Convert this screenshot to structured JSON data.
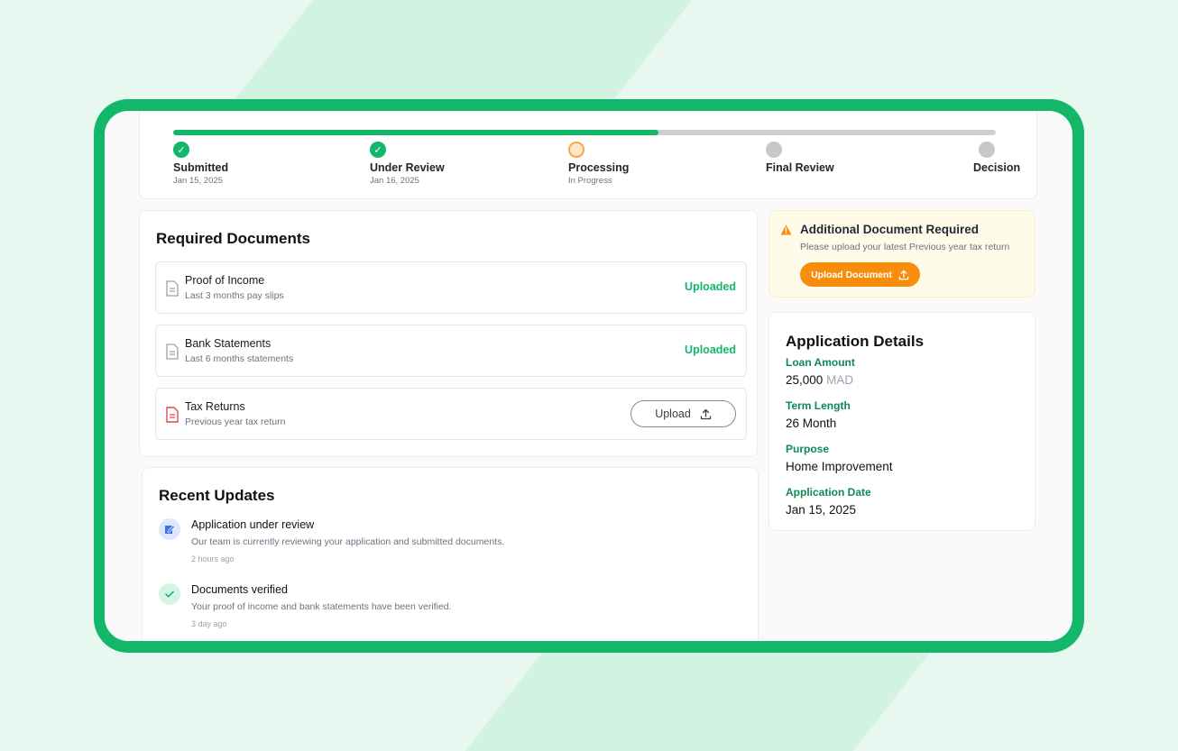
{
  "progress": {
    "fraction": 0.59,
    "steps": [
      {
        "label": "Submitted",
        "sub": "Jan 15, 2025",
        "state": "done"
      },
      {
        "label": "Under Review",
        "sub": "Jan 16, 2025",
        "state": "done"
      },
      {
        "label": "Processing",
        "sub": "In Progress",
        "state": "active"
      },
      {
        "label": "Final Review",
        "sub": "",
        "state": "pending"
      },
      {
        "label": "Decision",
        "sub": "",
        "state": "pending"
      }
    ]
  },
  "documents": {
    "title": "Required Documents",
    "items": [
      {
        "name": "Proof of Income",
        "desc": "Last 3 months pay slips",
        "status": "Uploaded"
      },
      {
        "name": "Bank Statements",
        "desc": "Last 6 months statements",
        "status": "Uploaded"
      },
      {
        "name": "Tax Returns",
        "desc": "Previous year tax return",
        "action": "Upload"
      }
    ]
  },
  "alert": {
    "title": "Additional Document Required",
    "desc": "Please upload your latest Previous year tax return",
    "button": "Upload Document"
  },
  "details": {
    "title": "Application Details",
    "loan_amount_label": "Loan Amount",
    "loan_amount_value": "25,000",
    "loan_amount_unit": "MAD",
    "term_label": "Term Length",
    "term_value": "26 Month",
    "purpose_label": "Purpose",
    "purpose_value": "Home Improvement",
    "date_label": "Application Date",
    "date_value": "Jan 15, 2025"
  },
  "updates": {
    "title": "Recent Updates",
    "items": [
      {
        "title": "Application under review",
        "desc": "Our team is currently reviewing your application and submitted documents.",
        "time": "2 hours ago"
      },
      {
        "title": "Documents verified",
        "desc": "Your proof of income and bank statements have been verified.",
        "time": "3 day ago"
      }
    ]
  },
  "colors": {
    "brand_green": "#12b76a",
    "accent_orange": "#f78d0b",
    "label_green": "#0e8a55"
  }
}
